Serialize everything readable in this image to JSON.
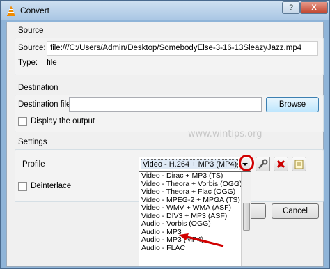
{
  "window": {
    "title": "Convert",
    "help": "?",
    "close": "X"
  },
  "source": {
    "group_label": "Source",
    "source_label": "Source:",
    "source_value": "file:///C:/Users/Admin/Desktop/SomebodyElse-3-16-13SleazyJazz.mp4",
    "type_label": "Type:",
    "type_value": "file"
  },
  "destination": {
    "group_label": "Destination",
    "file_label": "Destination file:",
    "file_value": "",
    "browse_label": "Browse",
    "display_output_label": "Display the output"
  },
  "settings": {
    "group_label": "Settings",
    "profile_label": "Profile",
    "profile_selected": "Video - H.264 + MP3 (MP4)",
    "deinterlace_label": "Deinterlace",
    "profile_options": [
      "Video - Dirac + MP3 (TS)",
      "Video - Theora + Vorbis (OGG)",
      "Video - Theora + Flac (OGG)",
      "Video - MPEG-2 + MPGA (TS)",
      "Video - WMV + WMA (ASF)",
      "Video - DIV3 + MP3 (ASF)",
      "Audio - Vorbis (OGG)",
      "Audio - MP3",
      "Audio - MP3 (MP4)",
      "Audio - FLAC"
    ]
  },
  "footer": {
    "cancel_label": "Cancel"
  },
  "watermark": "www.wintips.org",
  "colors": {
    "annotation_red": "#d10000",
    "delete_red": "#cc0000"
  }
}
